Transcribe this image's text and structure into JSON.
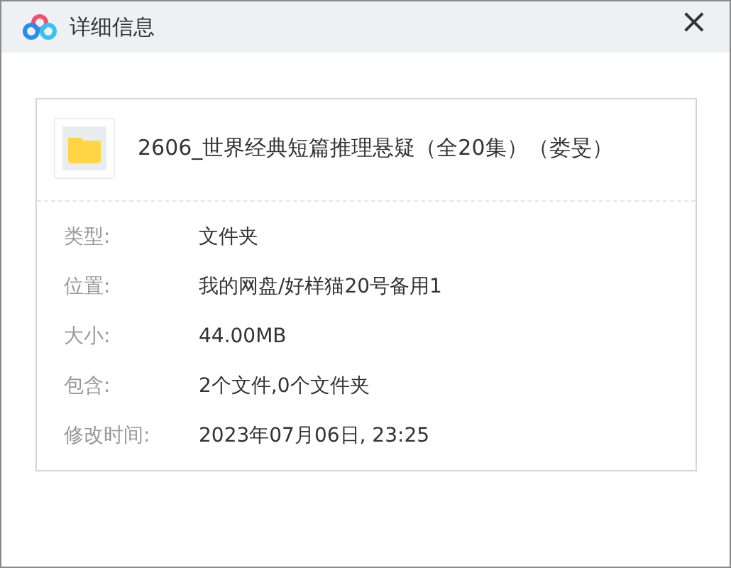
{
  "window": {
    "title": "详细信息",
    "close": "×"
  },
  "item": {
    "name": "2606_世界经典短篇推理悬疑（全20集）（娄旻）"
  },
  "details": [
    {
      "label": "类型:",
      "value": "文件夹"
    },
    {
      "label": "位置:",
      "value": "我的网盘/好样猫20号备用1"
    },
    {
      "label": "大小:",
      "value": "44.00MB"
    },
    {
      "label": "包含:",
      "value": "2个文件,0个文件夹"
    },
    {
      "label": "修改时间:",
      "value": "2023年07月06日, 23:25"
    }
  ]
}
